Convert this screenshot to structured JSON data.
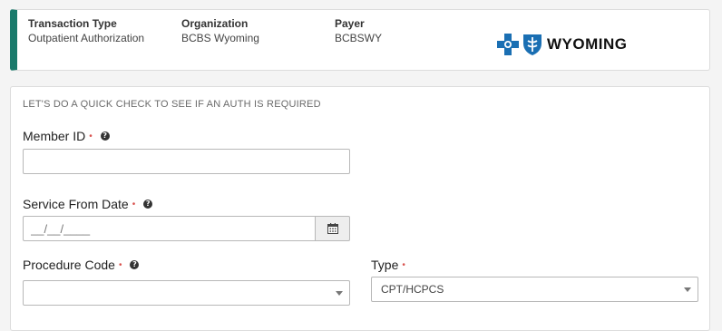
{
  "summary": {
    "transaction_type_label": "Transaction Type",
    "transaction_type_value": "Outpatient Authorization",
    "organization_label": "Organization",
    "organization_value": "BCBS Wyoming",
    "payer_label": "Payer",
    "payer_value": "BCBSWY",
    "logo_text": "WYOMING",
    "accent_color": "#1a7a6b"
  },
  "form": {
    "intro": "LET'S DO A QUICK CHECK TO SEE IF AN AUTH IS REQUIRED",
    "member_id": {
      "label": "Member ID",
      "required_mark": "•",
      "help": "?",
      "value": ""
    },
    "service_from_date": {
      "label": "Service From Date",
      "required_mark": "•",
      "help": "?",
      "placeholder": "__/__/____",
      "calendar_icon": "calendar-icon"
    },
    "procedure_code": {
      "label": "Procedure Code",
      "required_mark": "•",
      "help": "?",
      "value": ""
    },
    "type": {
      "label": "Type",
      "required_mark": "•",
      "value": "CPT/HCPCS"
    }
  }
}
